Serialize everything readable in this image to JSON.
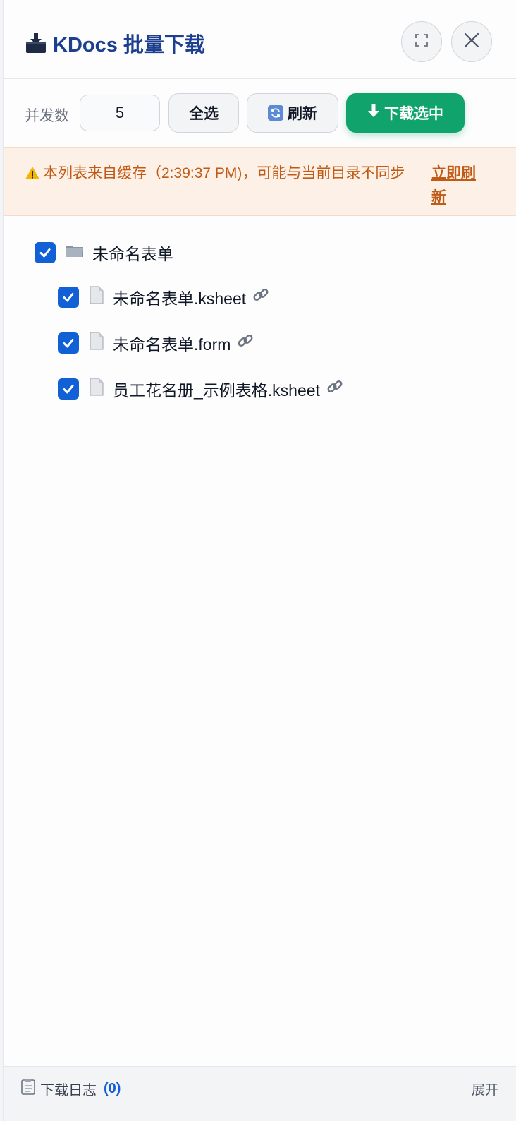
{
  "header": {
    "title": "KDocs 批量下载",
    "title_icon": "download-tray-icon",
    "fullscreen_icon": "fullscreen-icon",
    "close_icon": "close-icon"
  },
  "toolbar": {
    "concurrency_label": "并发数",
    "concurrency_value": "5",
    "select_all_label": "全选",
    "refresh_label": "刷新",
    "download_label": "下载选中"
  },
  "warning": {
    "text": "本列表来自缓存（2:39:37 PM)，可能与当前目录不同步",
    "link": "立即刷新"
  },
  "tree": {
    "folder": {
      "name": "未命名表单",
      "checked": true
    },
    "files": [
      {
        "name": "未命名表单.ksheet",
        "checked": true
      },
      {
        "name": "未命名表单.form",
        "checked": true
      },
      {
        "name": "员工花名册_示例表格.ksheet",
        "checked": true
      }
    ]
  },
  "footer": {
    "log_label": "下载日志",
    "log_count": "(0)",
    "expand_label": "展开"
  },
  "colors": {
    "title": "#1d3f8f",
    "primary": "#10a36c",
    "checkbox": "#1160d6",
    "warning_text": "#c05a14",
    "warning_bg": "#fdf1e7"
  }
}
